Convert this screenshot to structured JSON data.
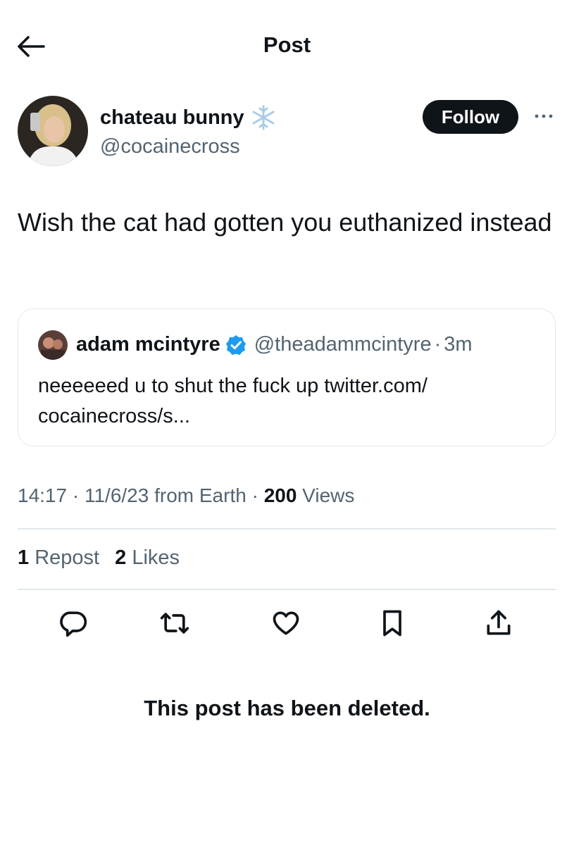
{
  "header": {
    "title": "Post",
    "back_icon": "arrow-left-icon"
  },
  "post": {
    "author": {
      "display_name": "chateau bunny",
      "name_emoji": "snowflake-icon",
      "handle": "@cocainecross"
    },
    "follow_label": "Follow",
    "more_icon": "more-icon",
    "text": "Wish the cat had gotten you euthanized instead",
    "quote": {
      "display_name": "adam mcintyre",
      "verified_icon": "verified-badge-icon",
      "handle": "@theadammcintyre",
      "separator": "·",
      "time": "3m",
      "text": "neeeeeed u to shut the fuck up twitter.com/ cocainecross/s..."
    },
    "meta": {
      "time": "14:17",
      "sep1": " · ",
      "date": "11/6/23",
      "location": " from Earth",
      "sep2": " · ",
      "views_count": "200",
      "views_label": " Views"
    },
    "stats": {
      "reposts_count": "1",
      "reposts_label": " Repost",
      "likes_count": "2",
      "likes_label": " Likes"
    },
    "actions": [
      "reply-icon",
      "repost-icon",
      "like-icon",
      "bookmark-icon",
      "share-icon"
    ]
  },
  "deleted_notice": "This post has been deleted.",
  "colors": {
    "text": "#0f1419",
    "muted": "#536471",
    "border": "#e1e8ed",
    "verified": "#1d9bf0",
    "follow_bg": "#0f1419"
  }
}
